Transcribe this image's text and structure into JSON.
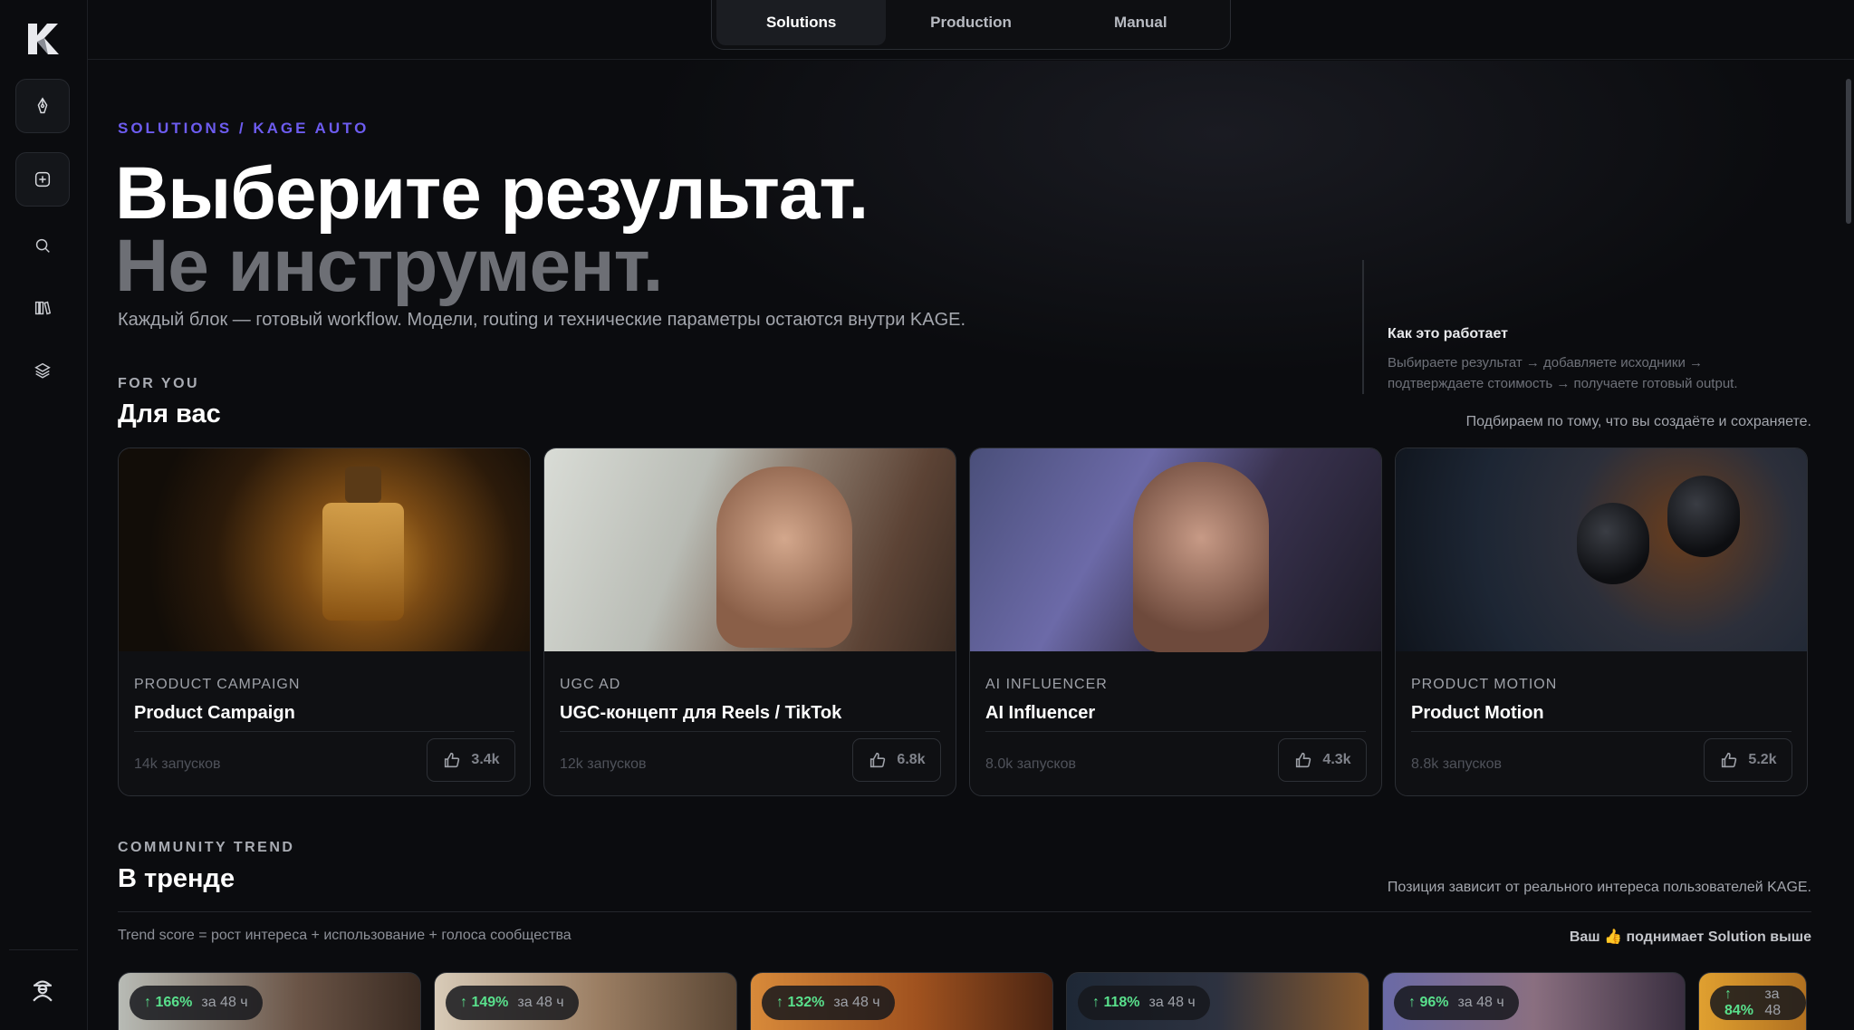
{
  "topbar": {
    "tabs": [
      {
        "label": "Solutions",
        "active": true
      },
      {
        "label": "Production",
        "active": false
      },
      {
        "label": "Manual",
        "active": false
      }
    ]
  },
  "sidebar": {
    "logo": "K",
    "items": [
      {
        "icon": "pen-nib-icon"
      },
      {
        "icon": "plus-square-icon"
      },
      {
        "icon": "search-icon"
      },
      {
        "icon": "library-icon"
      },
      {
        "icon": "layers-icon"
      }
    ],
    "bottom_icon": "agent-avatar-icon"
  },
  "hero": {
    "breadcrumb": "SOLUTIONS / KAGE AUTO",
    "title_line1": "Выберите результат.",
    "title_line2": "Не инструмент.",
    "lead": "Каждый блок — готовый workflow. Модели, routing и технические параметры остаются внутри KAGE."
  },
  "how_it_works": {
    "title": "Как это работает",
    "text": "Выбираете результат → добавляете исходники → подтверждаете стоимость → получаете готовый output."
  },
  "for_you": {
    "kicker": "FOR YOU",
    "title": "Для вас",
    "note": "Подбираем по тому, что вы создаёте и сохраняете.",
    "cards": [
      {
        "kicker": "PRODUCT CAMPAIGN",
        "title": "Product Campaign",
        "runs": "14k запусков",
        "likes": "3.4k"
      },
      {
        "kicker": "UGC AD",
        "title": "UGC-концепт для Reels / TikTok",
        "runs": "12k запусков",
        "likes": "6.8k"
      },
      {
        "kicker": "AI INFLUENCER",
        "title": "AI Influencer",
        "runs": "8.0k запусков",
        "likes": "4.3k"
      },
      {
        "kicker": "PRODUCT MOTION",
        "title": "Product Motion",
        "runs": "8.8k запусков",
        "likes": "5.2k"
      }
    ]
  },
  "trend": {
    "kicker": "COMMUNITY TREND",
    "title": "В тренде",
    "note": "Позиция зависит от реального интереса пользователей KAGE.",
    "formula": "Trend score = рост интереса + использование + голоса сообщества",
    "right_prefix": "Ваш",
    "right_emoji": "👍",
    "right_suffix": "поднимает Solution выше",
    "items": [
      {
        "growth": "↑ 166%",
        "period": "за 48 ч"
      },
      {
        "growth": "↑ 149%",
        "period": "за 48 ч"
      },
      {
        "growth": "↑ 132%",
        "period": "за 48 ч"
      },
      {
        "growth": "↑ 118%",
        "period": "за 48 ч"
      },
      {
        "growth": "↑ 96%",
        "period": "за 48 ч"
      },
      {
        "growth": "↑ 84%",
        "period": "за 48"
      }
    ]
  },
  "colors": {
    "accent": "#6d5cf0",
    "growth": "#59e08c",
    "background": "#0b0c0f"
  }
}
